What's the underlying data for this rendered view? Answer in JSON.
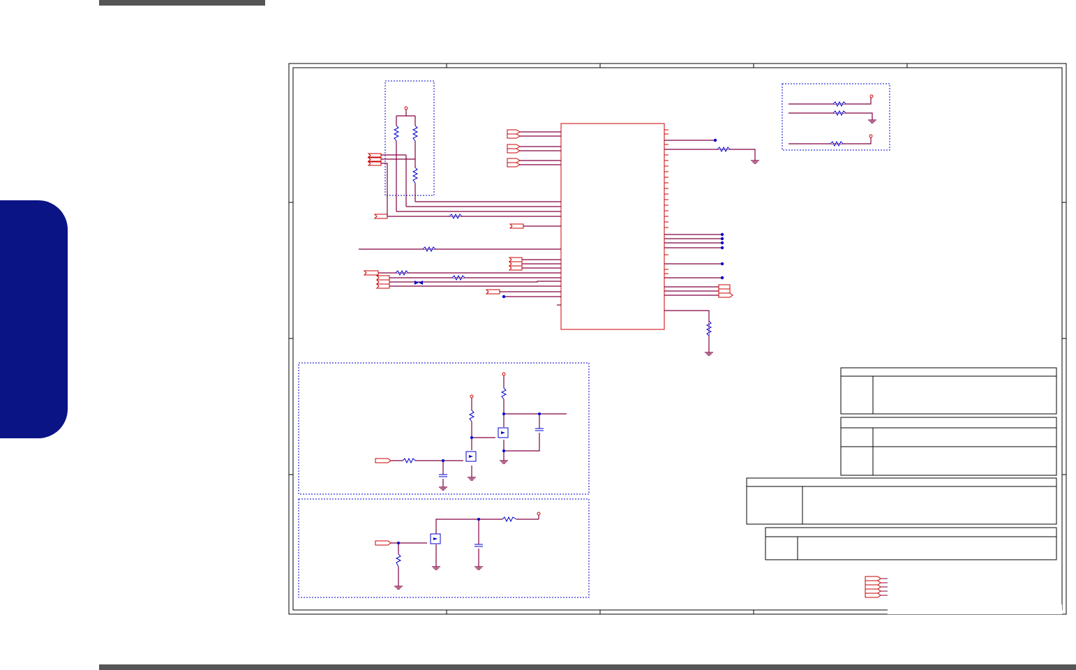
{
  "page": {
    "background": "#ffffff",
    "header_bar_color": "#555555",
    "side_tab_color": "#0b1484"
  },
  "schematic": {
    "wire_color": "#800040",
    "pin_color": "#cc0000",
    "component_color": "#0000cc",
    "frame_color": "#000000",
    "blocks": [
      {
        "name": "pull-up-resistor-block",
        "border": "dashed"
      },
      {
        "name": "strap-resistor-block",
        "border": "dashed"
      },
      {
        "name": "mosfet-switch-block",
        "border": "dashed"
      },
      {
        "name": "mosfet-driver-block",
        "border": "dashed"
      }
    ],
    "title_tables": 4,
    "texts": []
  }
}
